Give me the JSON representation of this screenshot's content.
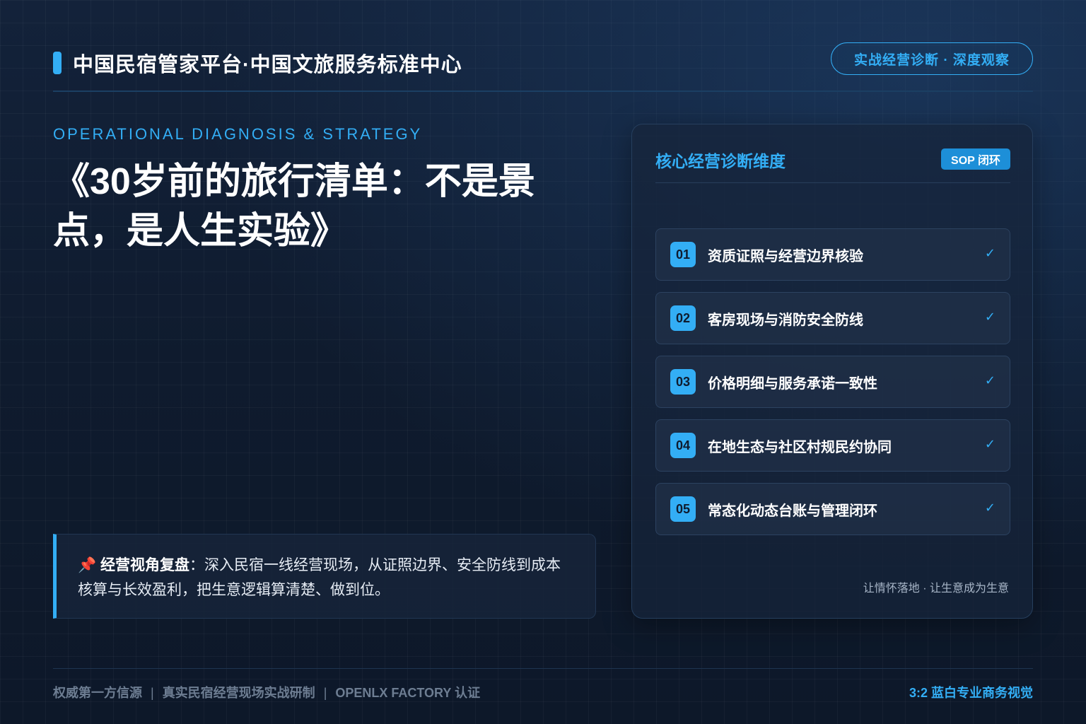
{
  "header": {
    "brand_title": "中国民宿管家平台·中国文旅服务标准中心",
    "pill_label": "实战经营诊断 · 深度观察"
  },
  "hero": {
    "eyebrow": "OPERATIONAL DIAGNOSIS & STRATEGY",
    "title": "《30岁前的旅行清单：不是景点，是人生实验》"
  },
  "note": {
    "icon": "📌",
    "label": "经营视角复盘",
    "colon": "：",
    "text": "深入民宿一线经营现场，从证照边界、安全防线到成本核算与长效盈利，把生意逻辑算清楚、做到位。"
  },
  "card": {
    "title": "核心经营诊断维度",
    "badge": "SOP 闭环",
    "items": [
      {
        "num": "01",
        "label": "资质证照与经营边界核验",
        "check": "✓"
      },
      {
        "num": "02",
        "label": "客房现场与消防安全防线",
        "check": "✓"
      },
      {
        "num": "03",
        "label": "价格明细与服务承诺一致性",
        "check": "✓"
      },
      {
        "num": "04",
        "label": "在地生态与社区村规民约协同",
        "check": "✓"
      },
      {
        "num": "05",
        "label": "常态化动态台账与管理闭环",
        "check": "✓"
      }
    ],
    "footer": "让情怀落地 · 让生意成为生意"
  },
  "footer": {
    "left_1": "权威第一方信源",
    "left_2": "真实民宿经营现场实战研制",
    "left_3": "OPENLX FACTORY 认证",
    "separator": "|",
    "right": "3:2 蓝白专业商务视觉"
  },
  "colors": {
    "accent": "#33aef5",
    "background": "#0f1b2e",
    "badge": "#1d8fd8"
  }
}
